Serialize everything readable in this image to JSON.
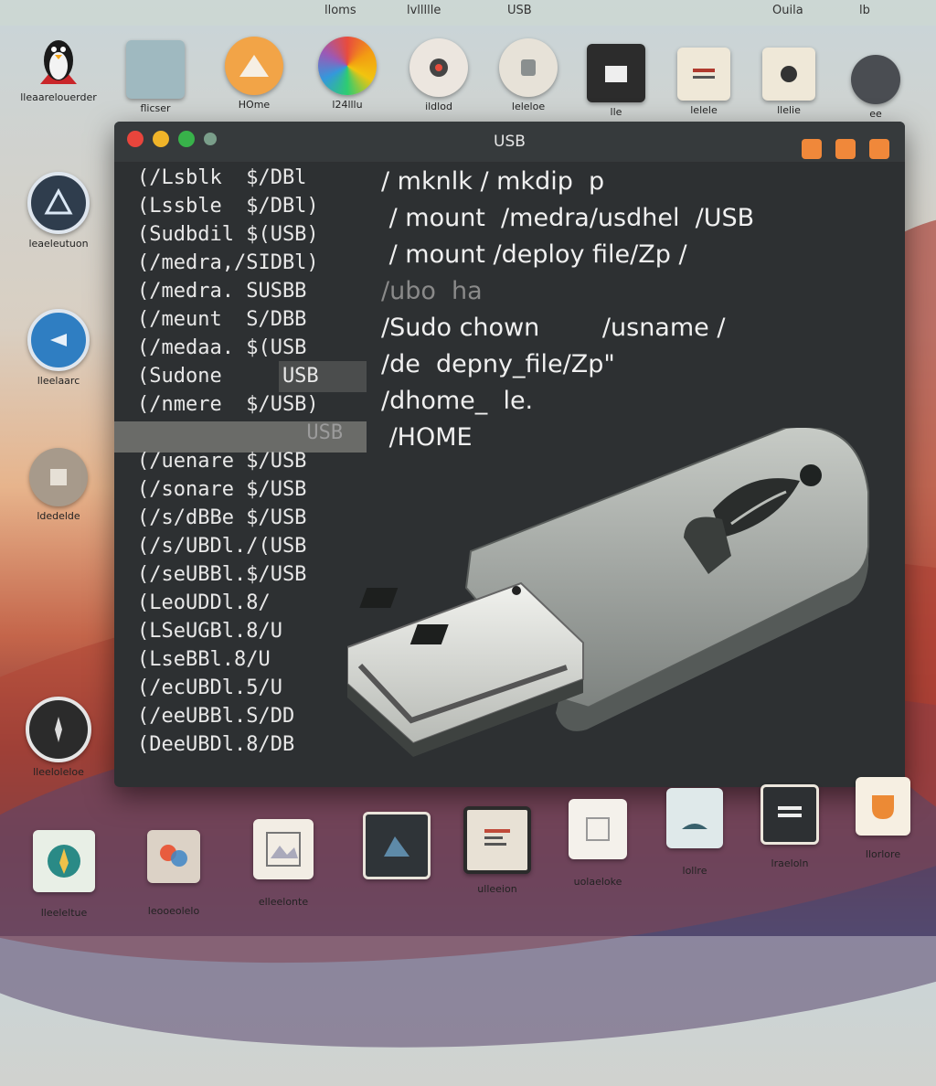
{
  "topbar": {
    "items": [
      "lloms",
      "lvllllle",
      "USB",
      "Ouila",
      "lb"
    ]
  },
  "desktop_top_icons": [
    {
      "label": "lleaarelouerder",
      "icon": "linux-penguin-icon"
    },
    {
      "label": "flicser",
      "icon": "folder-icon"
    },
    {
      "label": "HOme",
      "icon": "home-icon"
    },
    {
      "label": "l24lllu",
      "icon": "color-wheel-icon"
    },
    {
      "label": "ildlod",
      "icon": "settings-icon"
    },
    {
      "label": "leleloe",
      "icon": "file-icon"
    },
    {
      "label": "lle",
      "icon": "folder-dark-icon"
    },
    {
      "label": "lelele",
      "icon": "document-icon"
    },
    {
      "label": "llelie",
      "icon": "app-icon"
    },
    {
      "label": "ee",
      "icon": "shield-icon"
    }
  ],
  "desktop_left_icons": [
    {
      "label": "leaeleutuon",
      "icon": "triangle-icon"
    },
    {
      "label": "lleelaarc",
      "icon": "disk-icon"
    },
    {
      "label": "ldedelde",
      "icon": "puzzle-icon"
    },
    {
      "label": "lleeloleloe",
      "icon": "compass-icon"
    }
  ],
  "dock_icons": [
    {
      "label": "lleeleltue",
      "icon": "star-icon"
    },
    {
      "label": "leooeolelo",
      "icon": "palette-icon"
    },
    {
      "label": "elleelonte",
      "icon": "image-icon"
    },
    {
      "label": "",
      "icon": "picture-icon"
    },
    {
      "label": "ulleeion",
      "icon": "chart-icon"
    },
    {
      "label": "uolaeloke",
      "icon": "paper-icon"
    },
    {
      "label": "lollre",
      "icon": "window-icon"
    },
    {
      "label": "lraeloln",
      "icon": "terminal-icon"
    },
    {
      "label": "llorlore",
      "icon": "orange-app-icon"
    }
  ],
  "terminal": {
    "title": "USB",
    "left_lines": [
      "(/Lsblk  $/DBl",
      "(Lssble  $/DBl)",
      "(Sudbdil $(USB)",
      "(/medra,/SIDBl)",
      "(/medra. SUSBB",
      "(/meunt  S/DBB",
      "(/medaa. $(USB",
      "(Sudone     USB",
      "(/nmere  $/USB)",
      "              USB",
      "(/uenare $/USB",
      "(/sonare $/USB",
      "(/s/dBBe $/USB",
      "(/s/UBDl./(USB",
      "(/seUBBl.$/USB",
      "(LeoUDDl.8/",
      "(LSeUGBl.8/U",
      "(LseBBl.8/U",
      "(/ecUBDl.5/U",
      "(/eeUBBl.S/DD",
      "(DeeUBDl.8/DB"
    ],
    "right_lines": [
      "/ mknlk / mkdip  p",
      " / mount  /medra/usdhel  /USB",
      " / mount /deploy file/Zp /",
      "/ubo  ha",
      "/Sudo chown        /usname /",
      "/de  depny_file/Zp\"",
      "/dhome_  le.",
      " /HOME"
    ]
  },
  "colors": {
    "terminal_bg": "#2d3032",
    "close": "#e8453c",
    "minimize": "#f0b429",
    "maximize": "#38b24a",
    "accent_orange": "#f0883a"
  }
}
